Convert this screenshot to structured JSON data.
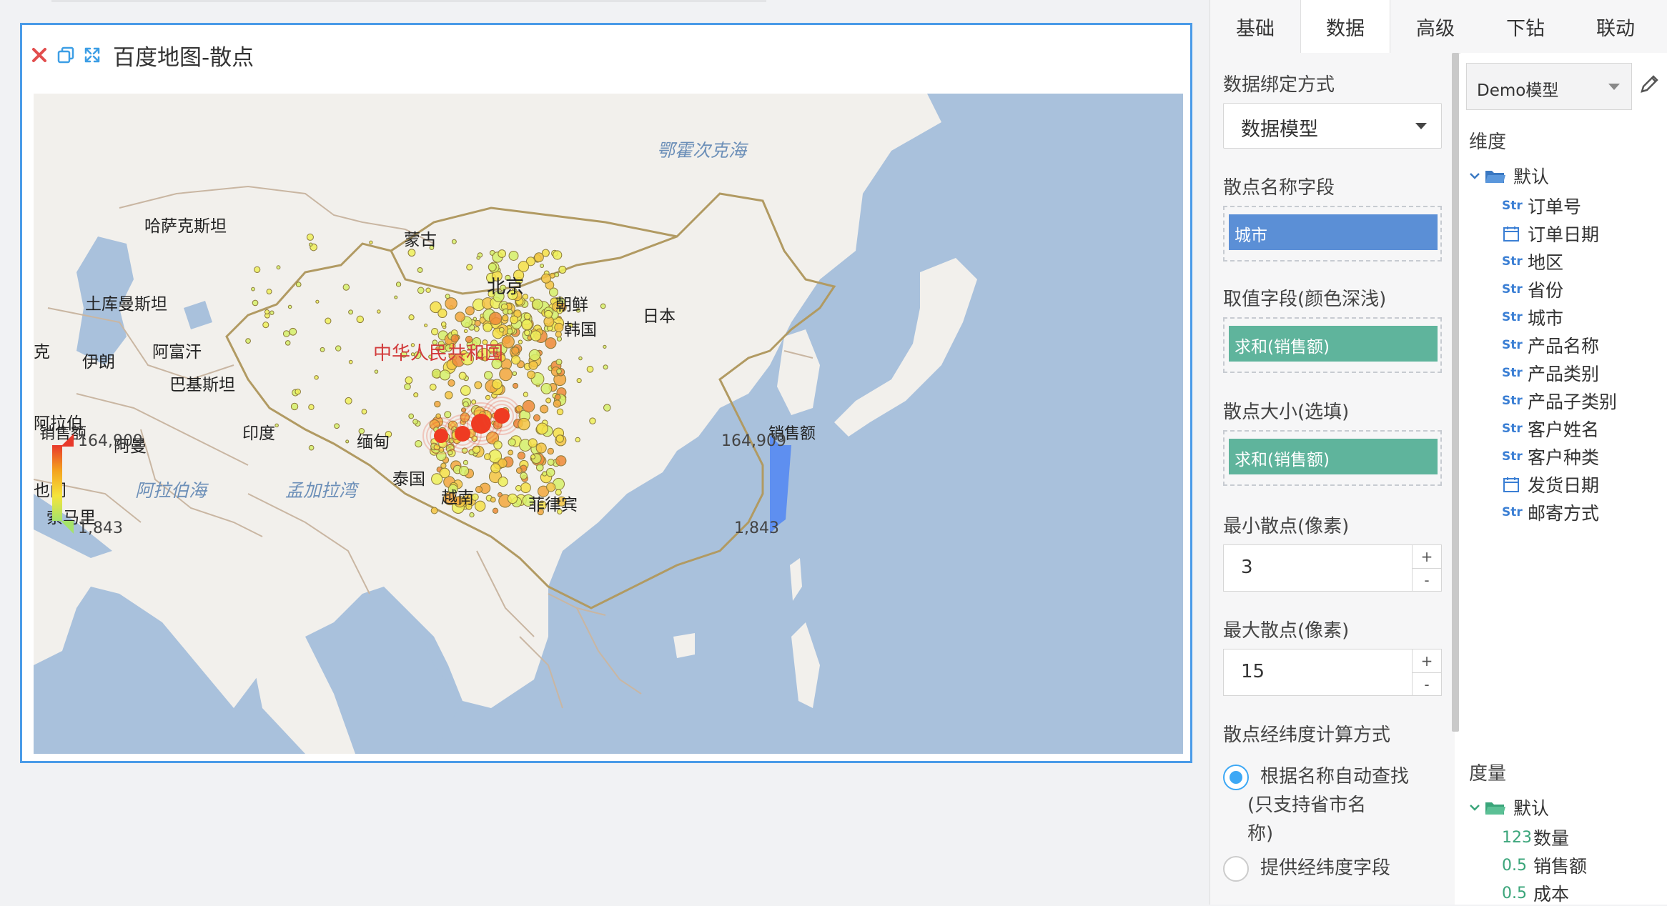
{
  "widget": {
    "title": "百度地图-散点",
    "icons": [
      "close-icon",
      "copy-icon",
      "expand-icon"
    ]
  },
  "map": {
    "countries": {
      "kazakhstan": "哈萨克斯坦",
      "mongolia": "蒙古",
      "turkmenistan": "土库曼斯坦",
      "afghanistan": "阿富汗",
      "iran": "伊朗",
      "pakistan": "巴基斯坦",
      "china": "中华人民共和国",
      "beijing": "北京",
      "north_korea": "朝鲜",
      "south_korea": "韩国",
      "japan": "日本",
      "india": "印度",
      "myanmar": "缅甸",
      "thailand": "泰国",
      "vietnam": "越南",
      "philippines": "菲律宾",
      "arabia": "阿拉伯",
      "oman": "阿曼",
      "yemen": "也门",
      "somalia": "索马里",
      "edge_k": "克"
    },
    "seas": {
      "okhotsk": "鄂霍次克海",
      "arabian_sea": "阿拉伯海",
      "bay_of_bengal": "孟加拉湾"
    },
    "legend_left": {
      "title": "销售额",
      "max": "164,909",
      "min": "1,843"
    },
    "legend_right": {
      "title": "销售额",
      "max": "164,909",
      "min": "1,843"
    }
  },
  "panel": {
    "tabs": [
      "基础",
      "数据",
      "高级",
      "下钻",
      "联动"
    ],
    "active_tab": "数据",
    "binding_label": "数据绑定方式",
    "binding_value": "数据模型",
    "name_field_label": "散点名称字段",
    "name_field_value": "城市",
    "value_field_label": "取值字段(颜色深浅)",
    "value_field_value": "求和(销售额)",
    "size_field_label": "散点大小(选填)",
    "size_field_value": "求和(销售额)",
    "min_label": "最小散点(像素)",
    "min_value": "3",
    "max_label": "最大散点(像素)",
    "max_value": "15",
    "geo_label": "散点经纬度计算方式",
    "geo_opt1_line1": "根据名称自动查找",
    "geo_opt1_line2": "(只支持省市名",
    "geo_opt1_line3": "称)",
    "geo_opt2": "提供经纬度字段",
    "plus": "+",
    "minus": "-",
    "colors": {
      "blue_chip": "#5b8fd6",
      "green_chip": "#5fb49c",
      "accent": "#3da8f5"
    }
  },
  "fields": {
    "model": "Demo模型",
    "dimension_title": "维度",
    "dim_folder": "默认",
    "dimensions": [
      {
        "type": "Str",
        "name": "订单号"
      },
      {
        "type": "date",
        "name": "订单日期"
      },
      {
        "type": "Str",
        "name": "地区"
      },
      {
        "type": "Str",
        "name": "省份"
      },
      {
        "type": "Str",
        "name": "城市"
      },
      {
        "type": "Str",
        "name": "产品名称"
      },
      {
        "type": "Str",
        "name": "产品类别"
      },
      {
        "type": "Str",
        "name": "产品子类别"
      },
      {
        "type": "Str",
        "name": "客户姓名"
      },
      {
        "type": "Str",
        "name": "客户种类"
      },
      {
        "type": "date",
        "name": "发货日期"
      },
      {
        "type": "Str",
        "name": "邮寄方式"
      }
    ],
    "measure_title": "度量",
    "measure_folder": "默认",
    "measures": [
      {
        "type": "123",
        "name": "数量"
      },
      {
        "type": "0.5",
        "name": "销售额"
      },
      {
        "type": "0.5",
        "name": "成本"
      }
    ]
  }
}
